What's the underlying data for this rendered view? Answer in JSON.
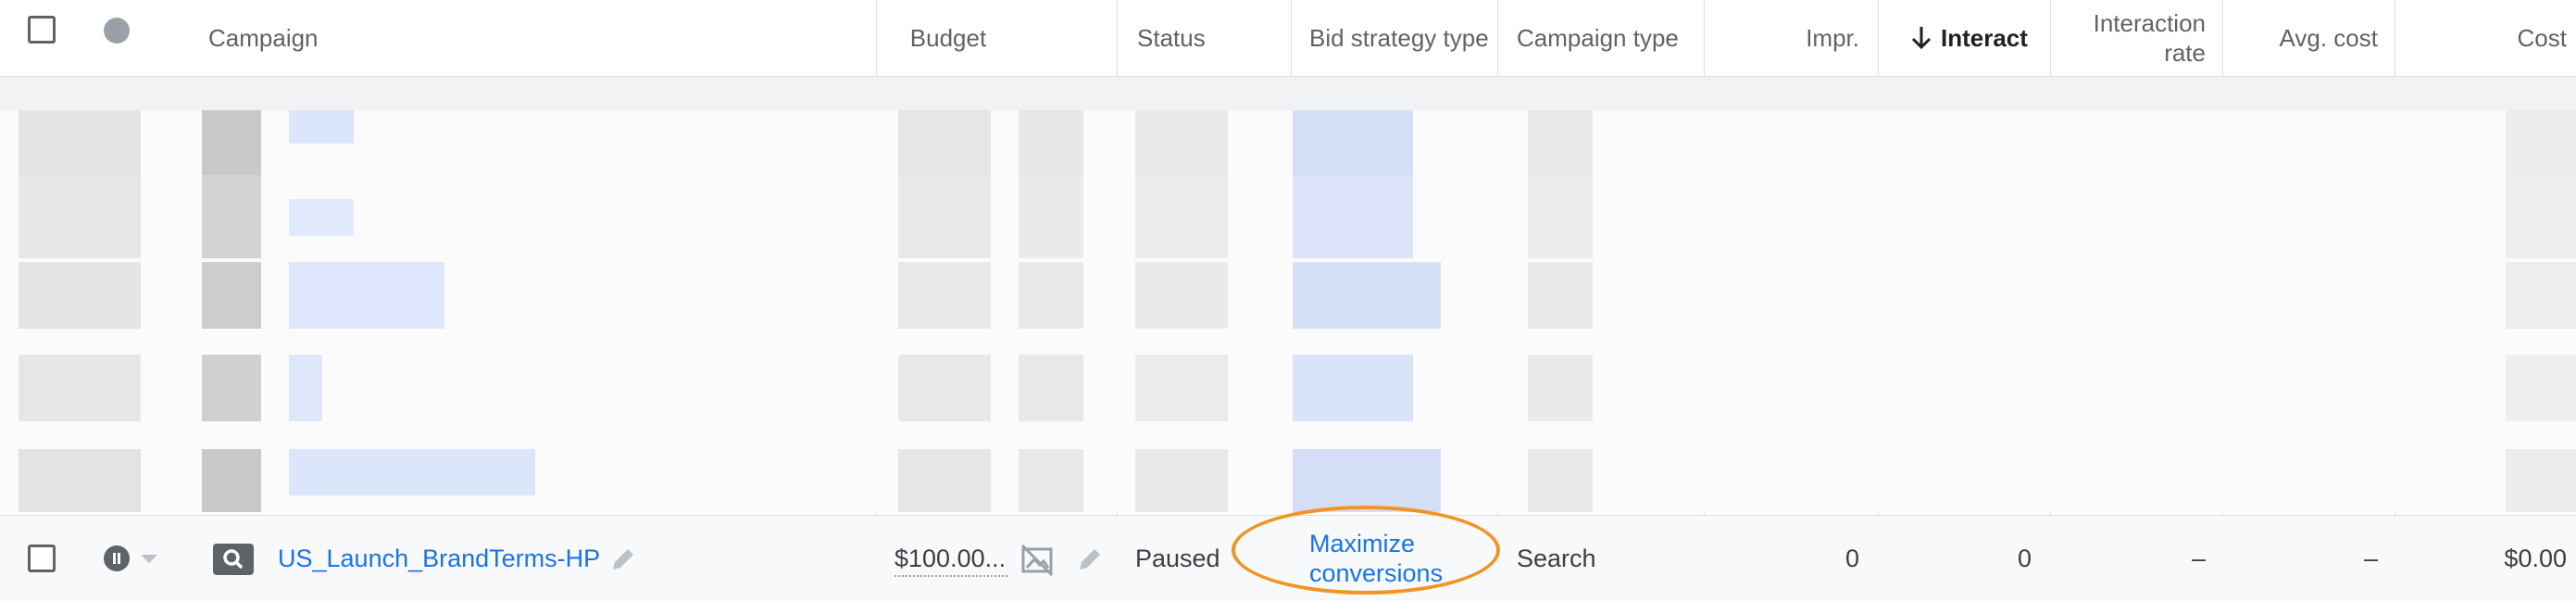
{
  "header": {
    "campaign": "Campaign",
    "budget": "Budget",
    "status": "Status",
    "bid_strategy_type": "Bid strategy type",
    "campaign_type": "Campaign type",
    "impr": "Impr.",
    "interactions": "Interact",
    "interaction_rate": "Interaction rate",
    "avg_cost": "Avg. cost",
    "cost": "Cost"
  },
  "row": {
    "campaign_name": "US_Launch_BrandTerms-HP",
    "budget": "$100.00...",
    "status": "Paused",
    "bid_strategy": "Maximize conversions",
    "campaign_type": "Search",
    "impr": "0",
    "interactions": "0",
    "interaction_rate": "–",
    "avg_cost": "–",
    "cost": "$0.00"
  },
  "icons": {
    "select_all": "checkbox-icon",
    "status_dot": "status-dot-icon",
    "sort": "arrow-down-icon",
    "paused": "pause-circle-icon",
    "search_type": "search-icon",
    "edit": "pencil-icon",
    "no_budget_image": "image-off-icon"
  },
  "colors": {
    "link": "#1a73e8",
    "highlight": "#f29423",
    "text": "#3c4043"
  }
}
